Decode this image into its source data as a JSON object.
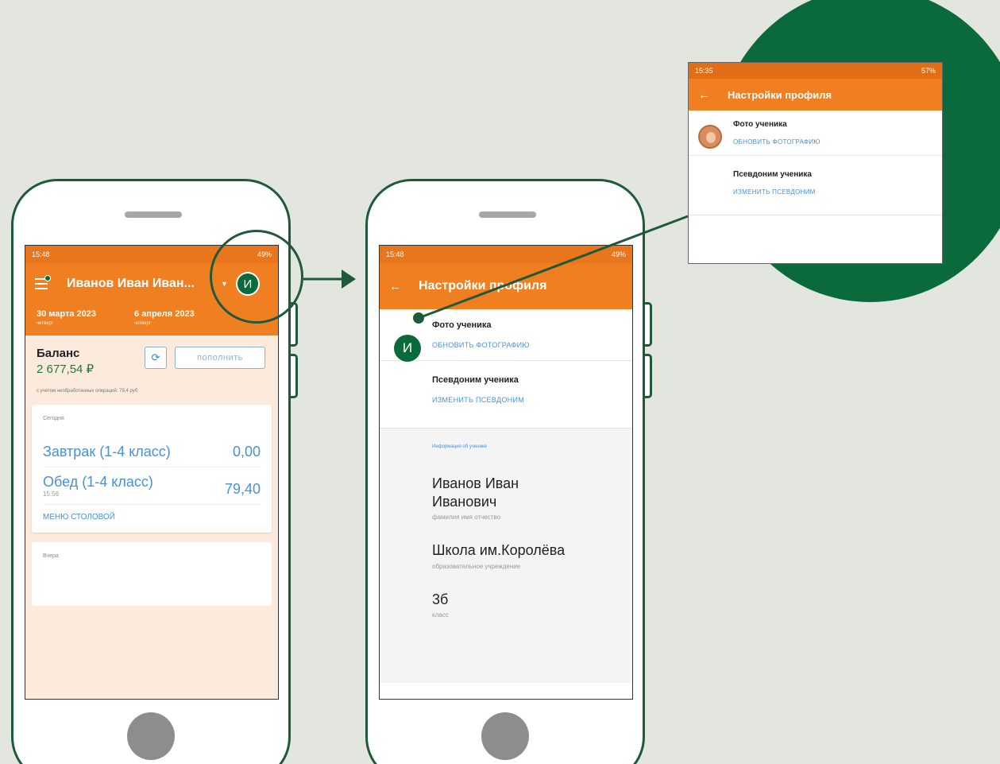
{
  "colors": {
    "brand_green": "#0b6a3b",
    "app_orange": "#f07f22",
    "link_blue": "#4a90d9",
    "background": "#e3e6df"
  },
  "phone1": {
    "status": {
      "time": "15:48",
      "icons": "49%"
    },
    "appbar": {
      "menu_icon": "hamburger-icon",
      "title": "Иванов Иван Иван...",
      "dropdown_icon": "caret-down-icon",
      "avatar": "И"
    },
    "dates": [
      {
        "date": "30 марта 2023",
        "weekday": "четверг"
      },
      {
        "date": "6 апреля 2023",
        "weekday": "четверг"
      }
    ],
    "balance": {
      "label": "Баланс",
      "amount": "2 677,54 ₽",
      "refresh_icon": "refresh-icon",
      "topup": "пополнить",
      "note": "с учетом необработанных операций: 79,4 руб"
    },
    "today": {
      "header": "Сегодня",
      "items": [
        {
          "name": "Завтрак (1-4 класс)",
          "price": "0,00",
          "time": ""
        },
        {
          "name": "Обед (1-4 класс)",
          "price": "79,40",
          "time": "15:56"
        }
      ],
      "menu_link": "меню столовой"
    },
    "yesterday": {
      "header": "Вчера"
    }
  },
  "phone2": {
    "status": {
      "time": "15:48",
      "icons": "49%"
    },
    "appbar": {
      "back_icon": "arrow-left-icon",
      "title": "Настройки профиля"
    },
    "photo": {
      "avatar": "И",
      "title": "Фото ученика",
      "action": "обновить фотографию"
    },
    "alias": {
      "title": "Псевдоним ученика",
      "action": "изменить псевдоним"
    },
    "info": {
      "header": "Информация об ученике",
      "fio": "Иванов Иван Иванович",
      "fio_label": "фамилия имя отчество",
      "school": "Школа им.Королёва",
      "school_label": "образовательное учреждение",
      "class": "3б",
      "class_label": "класс"
    }
  },
  "inset": {
    "status": {
      "time": "15:35",
      "icons": "57%"
    },
    "appbar": {
      "back_icon": "arrow-left-icon",
      "title": "Настройки профиля"
    },
    "photo": {
      "title": "Фото ученика",
      "action": "обновить фотографию"
    },
    "alias": {
      "title": "Псевдоним ученика",
      "action": "изменить псевдоним"
    }
  }
}
